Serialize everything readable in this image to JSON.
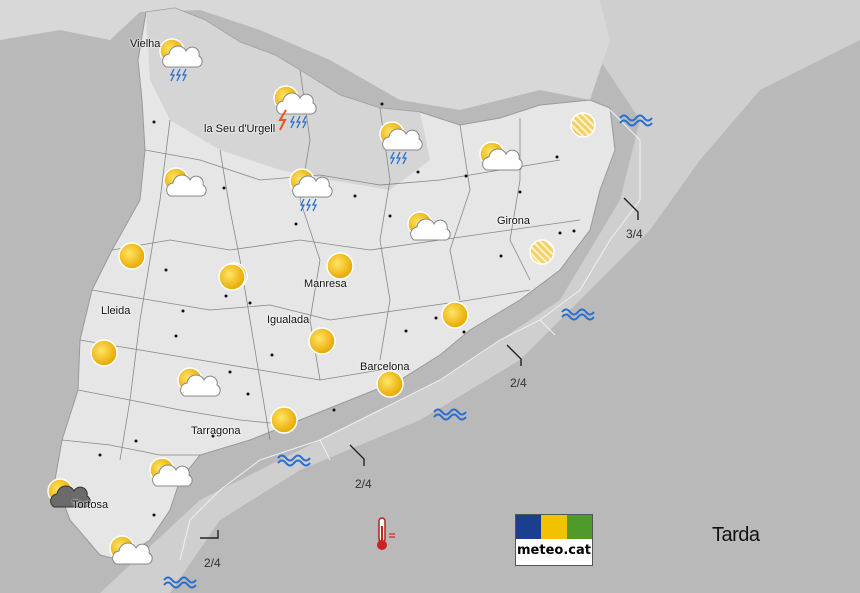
{
  "period_label": "Tarda",
  "logo_text": "meteo.cat",
  "cities": [
    {
      "name": "Vielha"
    },
    {
      "name": "la Seu d'Urgell"
    },
    {
      "name": "Lleida"
    },
    {
      "name": "Manresa"
    },
    {
      "name": "Igualada"
    },
    {
      "name": "Girona"
    },
    {
      "name": "Barcelona"
    },
    {
      "name": "Tarragona"
    },
    {
      "name": "Tortosa"
    }
  ],
  "sea_state": [
    "3/4",
    "2/4",
    "2/4",
    "2/4"
  ],
  "forecast_icons": [
    "sun-cloud-rain-icon",
    "sun-cloud-storm-icon",
    "sun-cloud-rain-icon",
    "sun-cloud-rain-icon",
    "sun-cloud-icon",
    "sun-cloud-icon",
    "sun-cloud-icon",
    "sun-cloud-icon",
    "sun-cloud-icon",
    "sun-cloud-icon",
    "sun-cloud-dark-icon",
    "sun-icon",
    "sun-icon",
    "sun-icon",
    "sun-icon",
    "sun-icon",
    "sun-icon",
    "sun-icon",
    "sun-icon",
    "sun-icon",
    "haze-icon",
    "haze-icon"
  ],
  "colors": {
    "sun": "#f5c000",
    "cloud": "#ffffff",
    "rain": "#2a6fcf",
    "sea_waves": "#2a6fcf",
    "haze": "#e8b830"
  }
}
